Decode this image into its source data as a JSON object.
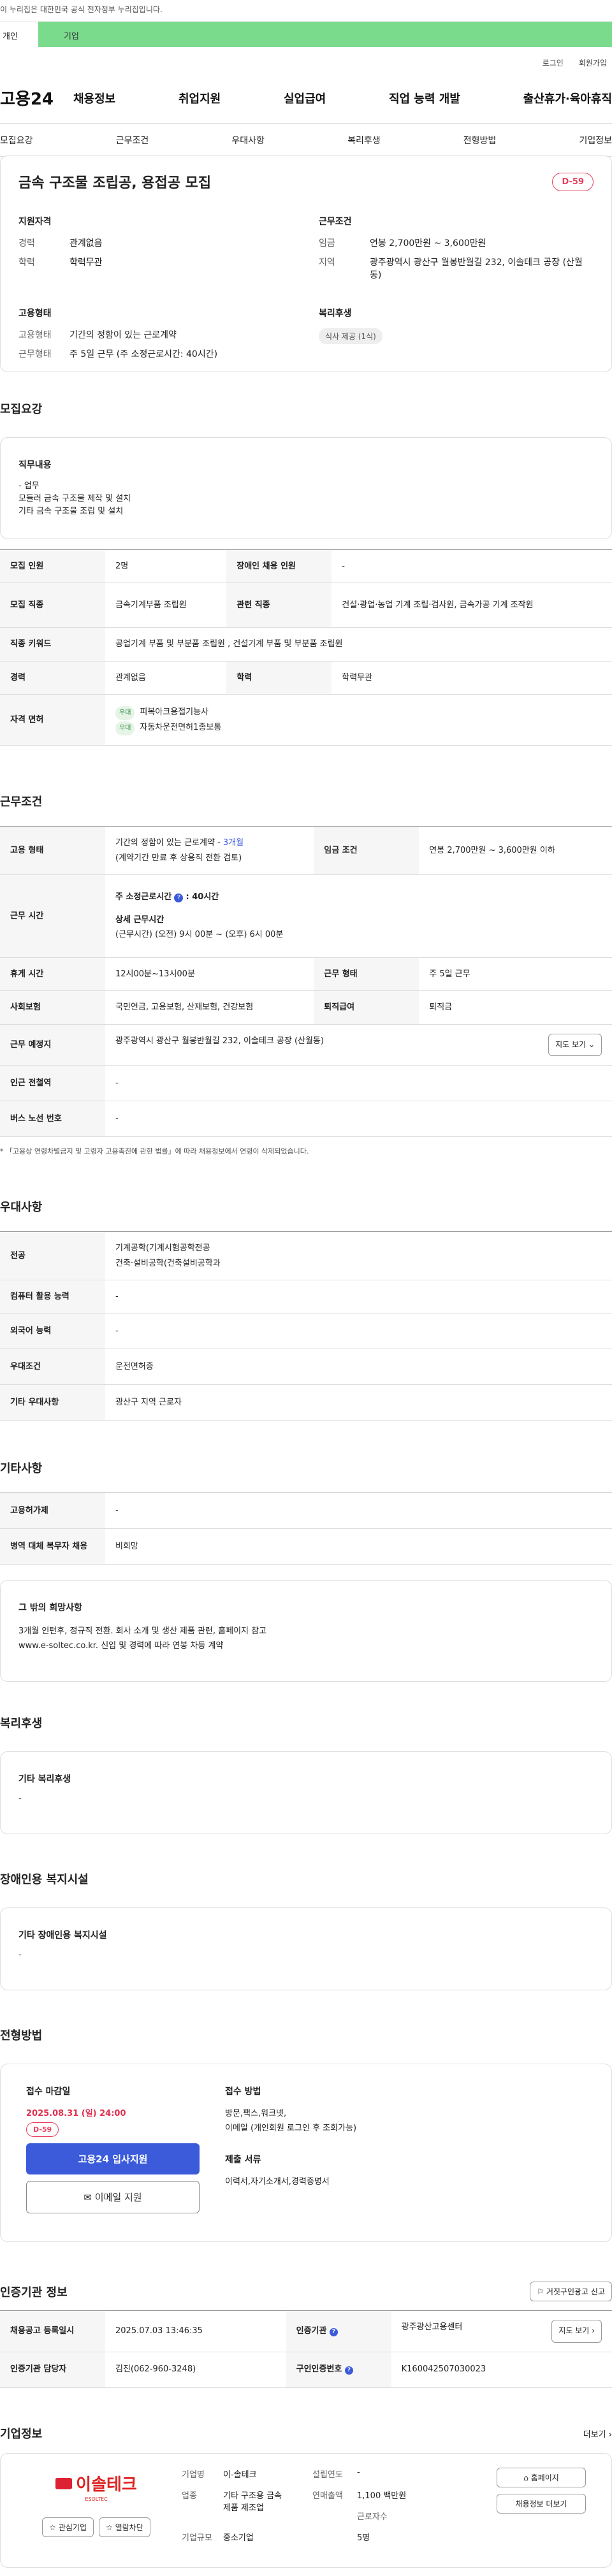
{
  "gov_banner": {
    "notice": "이 누리집은 대한민국 공식 전자정부 누리집입니다.",
    "tab_personal": "개인",
    "tab_corp": "기업"
  },
  "util": {
    "login": "로그인",
    "signup": "회원가입"
  },
  "gnb": {
    "logo": "고용24",
    "menu": [
      "채용정보",
      "취업지원",
      "실업급여",
      "직업 능력 개발",
      "출산휴가·육아휴직"
    ]
  },
  "tabs": [
    "모집요강",
    "근무조건",
    "우대사항",
    "복리후생",
    "전형방법",
    "기업정보"
  ],
  "job": {
    "title": "금속 구조물 조립공, 용접공 모집",
    "dday": "D-59",
    "qual_title": "지원자격",
    "qual": [
      {
        "k": "경력",
        "v": "관계없음"
      },
      {
        "k": "학력",
        "v": "학력무관"
      }
    ],
    "cond_title": "근무조건",
    "cond": [
      {
        "k": "임금",
        "v": "연봉 2,700만원 ~ 3,600만원"
      },
      {
        "k": "지역",
        "v": "광주광역시 광산구 월봉반월길 232, 이솔테크 공장 (산월동)"
      }
    ],
    "emp_title": "고용형태",
    "emp": [
      {
        "k": "고용형태",
        "v": "기간의 정함이 있는 근로계약"
      },
      {
        "k": "근무형태",
        "v": "주 5일 근무 (주 소정근로시간: 40시간)"
      }
    ],
    "welfare_title": "복리후생",
    "welfare_chip": "식사 제공 (1식)"
  },
  "s1": {
    "title": "모집요강",
    "duty_title": "직무내용",
    "duty_lines": [
      "- 업무",
      "모듈러 금속 구조물 제작 및 설치",
      "기타 금속 구조물 조립 및 설치"
    ],
    "rows": {
      "r1k": "모집 인원",
      "r1v": "2명",
      "r1k2": "장애인 채용 인원",
      "r1v2": "-",
      "r2k": "모집 직종",
      "r2v": "금속기계부품 조립원",
      "r2k2": "관련 직종",
      "r2v2": "건설·광업·농업 기계 조립·검사원, 금속가공 기계 조작원",
      "r3k": "직종 키워드",
      "r3v": "공업기계 부품 및 부분품 조립원 , 건설기계 부품 및 부분품 조립원",
      "r4k": "경력",
      "r4v": "관계없음",
      "r4k2": "학력",
      "r4v2": "학력무관",
      "r5k": "자격 면허",
      "r5a_tag": "우대",
      "r5a": "피복아크용접기능사",
      "r5b_tag": "우대",
      "r5b": "자동차운전면허1종보통"
    }
  },
  "s2": {
    "title": "근무조건",
    "emp_k": "고용 형태",
    "emp_v1": "기간의 정함이 있는 근로계약 - ",
    "emp_v1b": "3개월",
    "emp_v2": "(계약기간 만료 후 상용직 전환 검토)",
    "wage_k": "임금 조건",
    "wage_v": "연봉 2,700만원 ~ 3,600만원 이하",
    "time_k": "근무 시간",
    "time_a": "주 소정근로시간",
    "time_a2": ": 40시간",
    "time_b": "상세 근무시간",
    "time_b2": "(근무시간) (오전) 9시 00분 ~ (오후) 6시 00분",
    "rest_k": "휴게 시간",
    "rest_v": "12시00분~13시00분",
    "wtype_k": "근무 형태",
    "wtype_v": "주 5일 근무",
    "ins_k": "사회보험",
    "ins_v": "국민연금, 고용보험, 산재보험, 건강보험",
    "ret_k": "퇴직급여",
    "ret_v": "퇴직금",
    "loc_k": "근무 예정지",
    "loc_v": "광주광역시 광산구 월봉반월길 232, 이솔테크 공장 (산월동)",
    "map_btn": "지도 보기",
    "sub_k": "인근 전철역",
    "sub_v": "-",
    "bus_k": "버스 노선 번호",
    "bus_v": "-",
    "note": "* 「고용상 연령차별금지 및 고령자 고용촉진에 관한 법률」에 따라 채용정보에서 연령이 삭제되었습니다."
  },
  "s3": {
    "title": "우대사항",
    "major_k": "전공",
    "major_v1": "기계공학(기계시험공학전공",
    "major_v2": "건축·설비공학(건축설비공학과",
    "pc_k": "컴퓨터 활용 능력",
    "pc_v": "-",
    "lang_k": "외국어 능력",
    "lang_v": "-",
    "pref_k": "우대조건",
    "pref_v": "운전면허증",
    "etc_k": "기타 우대사항",
    "etc_v": "광산구 지역 근로자"
  },
  "s4": {
    "title": "기타사항",
    "dis_k": "고용허가제",
    "dis_v": "-",
    "mil_k": "병역 대체 복무자 채용",
    "mil_v": "비희망",
    "other_title": "그 밖의 희망사항",
    "other_l1": "3개월 인턴후, 정규직 전환.  회사 소개 및 생산 제품 관련, 홈페이지 참고",
    "other_l2": "www.e-soltec.co.kr.   신입 및 경력에 따라 연봉 차등 계약"
  },
  "s5": {
    "title": "복리후생",
    "box_title": "기타 복리후생",
    "box_v": "-"
  },
  "s6": {
    "title": "장애인용 복지시설",
    "box_title": "기타 장애인용 복지시설",
    "box_v": "-"
  },
  "s7": {
    "title": "전형방법",
    "deadline_title": "접수 마감일",
    "deadline": "2025.08.31 (일) 24:00",
    "dday": "D-59",
    "apply_btn": "고용24 입사지원",
    "email_btn": "이메일 지원",
    "method_title": "접수 방법",
    "method_l1": "방문,팩스,워크넷,",
    "method_l2": "이메일 (개인회원 로그인 후 조회가능)",
    "docs_title": "제출 서류",
    "docs_v": "이력서,자기소개서,경력증명서"
  },
  "s8": {
    "title": "인증기관 정보",
    "report_btn": "거짓구인광고 신고",
    "reg_k": "채용공고 등록일시",
    "reg_v": "2025.07.03 13:46:35",
    "org_k": "인증기관",
    "org_v": "광주광산고용센터",
    "map_btn": "지도 보기",
    "mgr_k": "인증기관 담당자",
    "mgr_v": "김진(062-960-3248)",
    "no_k": "구인인증번호",
    "no_v": "K160042507030023"
  },
  "s9": {
    "title": "기업정보",
    "more": "더보기",
    "logo_text": "이솔테크",
    "logo_sub": "ESOLTEC",
    "interest_btn": "관심기업",
    "block_btn": "열람차단",
    "name_k": "기업명",
    "name_v": "이-솔테크",
    "year_k": "설립연도",
    "year_v": "-",
    "biz_k": "업종",
    "biz_v1": "기타 구조용 금속",
    "biz_v2": "제품 제조업",
    "sales_k": "연매출액",
    "sales_v": "1,100 백만원",
    "emp_k": "근로자수",
    "emp_v": "5명",
    "size_k": "기업규모",
    "size_v": "중소기업",
    "home_btn": "홈페이지",
    "jobs_btn": "채용정보 더보기"
  }
}
